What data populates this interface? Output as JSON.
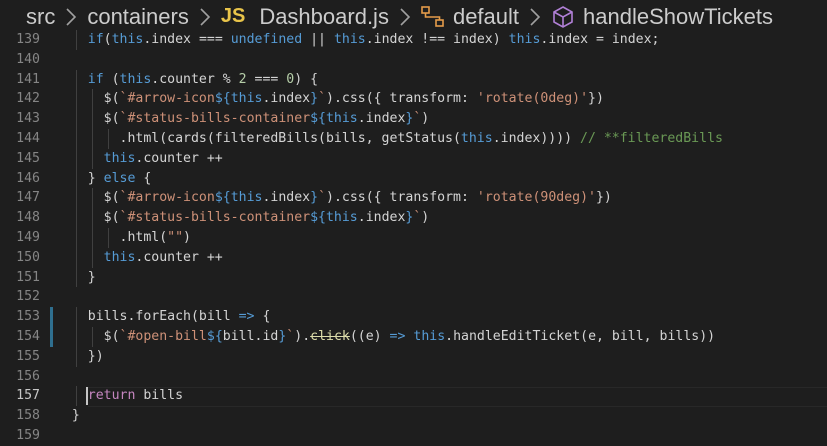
{
  "breadcrumb": {
    "segments": [
      "src",
      "containers",
      "Dashboard.js",
      "default",
      "handleShowTickets"
    ],
    "file_badge": "JS"
  },
  "editor": {
    "lines": [
      {
        "n": "139",
        "indent": 4,
        "tokens": [
          [
            "kw",
            "if"
          ],
          [
            "",
            "("
          ],
          [
            "kw",
            "this"
          ],
          [
            "",
            ".index "
          ],
          [
            "",
            "=== "
          ],
          [
            "kw",
            "undefined"
          ],
          [
            "",
            ""
          ],
          [
            "",
            " || "
          ],
          [
            "kw",
            "this"
          ],
          [
            "",
            ".index "
          ],
          [
            "",
            "!== "
          ],
          [
            "",
            "index) "
          ],
          [
            "kw",
            "this"
          ],
          [
            "",
            ".index = index;"
          ]
        ]
      },
      {
        "n": "140",
        "indent": 0,
        "tokens": []
      },
      {
        "n": "141",
        "indent": 4,
        "tokens": [
          [
            "kw",
            "if"
          ],
          [
            "",
            " ("
          ],
          [
            "kw",
            "this"
          ],
          [
            "",
            ".counter % "
          ],
          [
            "num",
            "2"
          ],
          [
            "",
            " === "
          ],
          [
            "num",
            "0"
          ],
          [
            "",
            ") {"
          ]
        ]
      },
      {
        "n": "142",
        "indent": 6,
        "tokens": [
          [
            "",
            "$("
          ],
          [
            "str",
            "`#arrow-icon"
          ],
          [
            "kw",
            "${"
          ],
          [
            "kw",
            "this"
          ],
          [
            "",
            ".index"
          ],
          [
            "kw",
            "}"
          ],
          [
            "str",
            "`"
          ],
          [
            "",
            ").css({ transform: "
          ],
          [
            "str",
            "'rotate(0deg)'"
          ],
          [
            "",
            "})"
          ]
        ]
      },
      {
        "n": "143",
        "indent": 6,
        "tokens": [
          [
            "",
            "$("
          ],
          [
            "str",
            "`#status-bills-container"
          ],
          [
            "kw",
            "${"
          ],
          [
            "kw",
            "this"
          ],
          [
            "",
            ".index"
          ],
          [
            "kw",
            "}"
          ],
          [
            "str",
            "`"
          ],
          [
            "",
            ")"
          ]
        ]
      },
      {
        "n": "144",
        "indent": 8,
        "tokens": [
          [
            "",
            ".html(cards(filteredBills(bills, getStatus("
          ],
          [
            "kw",
            "this"
          ],
          [
            "",
            ".index)))) "
          ],
          [
            "cmt",
            "// **filteredBills"
          ]
        ]
      },
      {
        "n": "145",
        "indent": 6,
        "tokens": [
          [
            "kw",
            "this"
          ],
          [
            "",
            ".counter ++"
          ]
        ]
      },
      {
        "n": "146",
        "indent": 4,
        "tokens": [
          [
            "",
            "} "
          ],
          [
            "kw",
            "else"
          ],
          [
            "",
            " {"
          ]
        ]
      },
      {
        "n": "147",
        "indent": 6,
        "tokens": [
          [
            "",
            "$("
          ],
          [
            "str",
            "`#arrow-icon"
          ],
          [
            "kw",
            "${"
          ],
          [
            "kw",
            "this"
          ],
          [
            "",
            ".index"
          ],
          [
            "kw",
            "}"
          ],
          [
            "str",
            "`"
          ],
          [
            "",
            ").css({ transform: "
          ],
          [
            "str",
            "'rotate(90deg)'"
          ],
          [
            "",
            "})"
          ]
        ]
      },
      {
        "n": "148",
        "indent": 6,
        "tokens": [
          [
            "",
            "$("
          ],
          [
            "str",
            "`#status-bills-container"
          ],
          [
            "kw",
            "${"
          ],
          [
            "kw",
            "this"
          ],
          [
            "",
            ".index"
          ],
          [
            "kw",
            "}"
          ],
          [
            "str",
            "`"
          ],
          [
            "",
            ")"
          ]
        ]
      },
      {
        "n": "149",
        "indent": 8,
        "tokens": [
          [
            "",
            ".html("
          ],
          [
            "str",
            "\"\""
          ],
          [
            "",
            ")"
          ]
        ]
      },
      {
        "n": "150",
        "indent": 6,
        "tokens": [
          [
            "kw",
            "this"
          ],
          [
            "",
            ".counter ++"
          ]
        ]
      },
      {
        "n": "151",
        "indent": 4,
        "tokens": [
          [
            "",
            "}"
          ]
        ]
      },
      {
        "n": "152",
        "indent": 0,
        "tokens": []
      },
      {
        "n": "153",
        "indent": 4,
        "tokens": [
          [
            "",
            "bills.forEach(bill "
          ],
          [
            "kw",
            "=>"
          ],
          [
            "",
            " {"
          ]
        ]
      },
      {
        "n": "154",
        "indent": 6,
        "tokens": [
          [
            "",
            "$("
          ],
          [
            "str",
            "`#open-bill"
          ],
          [
            "kw",
            "${"
          ],
          [
            "",
            "bill.id"
          ],
          [
            "kw",
            "}"
          ],
          [
            "str",
            "`"
          ],
          [
            "",
            ")."
          ],
          [
            "strike",
            "click"
          ],
          [
            "",
            "((e) "
          ],
          [
            "kw",
            "=>"
          ],
          [
            "",
            " "
          ],
          [
            "kw",
            "this"
          ],
          [
            "",
            ".handleEditTicket(e, bill, bills))"
          ]
        ]
      },
      {
        "n": "155",
        "indent": 4,
        "tokens": [
          [
            "",
            "})"
          ]
        ]
      },
      {
        "n": "156",
        "indent": 0,
        "tokens": []
      },
      {
        "n": "157",
        "indent": 4,
        "tokens": [
          [
            "ctl",
            "return"
          ],
          [
            "",
            " bills"
          ]
        ]
      },
      {
        "n": "158",
        "indent": 2,
        "tokens": [
          [
            "",
            "}"
          ]
        ]
      },
      {
        "n": "159",
        "indent": 0,
        "tokens": []
      }
    ],
    "active_line": "157"
  }
}
